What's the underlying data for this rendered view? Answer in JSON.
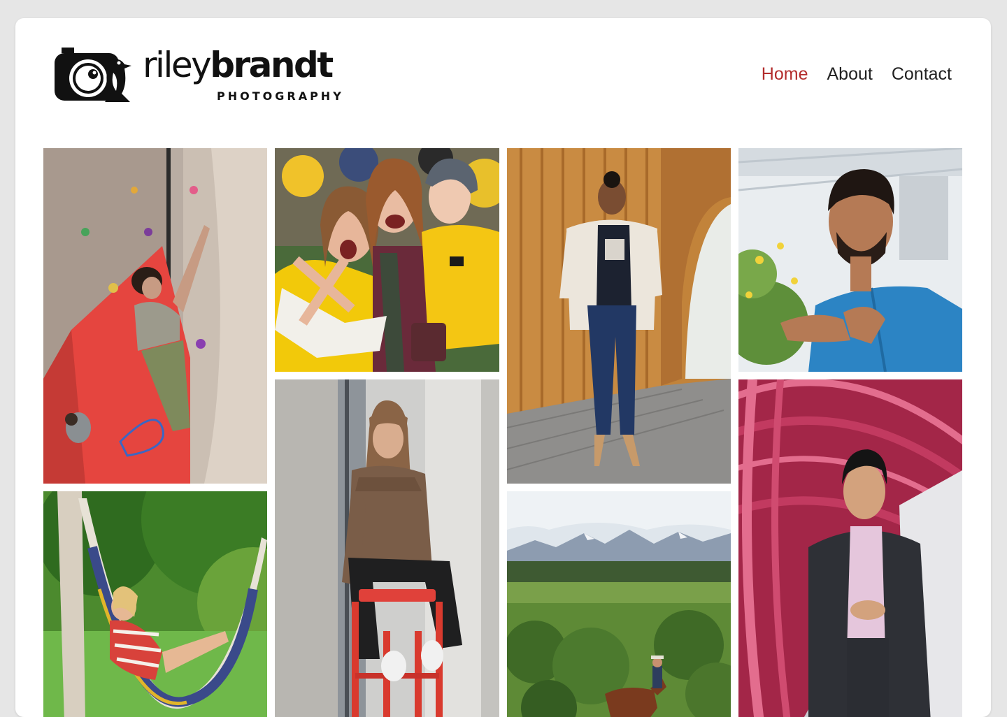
{
  "site": {
    "logo_text_light": "riley",
    "logo_text_bold": "brandt",
    "logo_subtitle": "PHOTOGRAPHY",
    "logo_icon": "camera-penguin-icon"
  },
  "nav": {
    "items": [
      {
        "label": "Home",
        "active": true
      },
      {
        "label": "About",
        "active": false
      },
      {
        "label": "Contact",
        "active": false
      }
    ],
    "active_color": "#b32d2d",
    "text_color": "#222222"
  },
  "gallery": {
    "photos": [
      {
        "subject": "rock climber on indoor climbing wall"
      },
      {
        "subject": "students in yellow shirts cheering"
      },
      {
        "subject": "woman in white blazer in wooden tunnel"
      },
      {
        "subject": "man in blue shirt examining plant"
      },
      {
        "subject": "woman in striped shirt relaxing in hammock"
      },
      {
        "subject": "woman in hijab seated on red stool"
      },
      {
        "subject": "horse rider in valley with mountains"
      },
      {
        "subject": "man in suit on red bridge"
      }
    ]
  }
}
